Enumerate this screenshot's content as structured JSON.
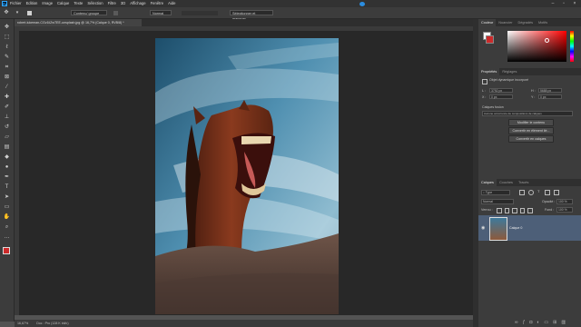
{
  "app": {
    "logo": "Ps"
  },
  "menu": [
    "Fichier",
    "Edition",
    "Image",
    "Calque",
    "Texte",
    "Sélection",
    "Filtre",
    "3D",
    "Affichage",
    "Fenêtre",
    "Aide"
  ],
  "options_bar": {
    "auto_select_label": "Contenu/ groupe",
    "style_label": "Normal",
    "select_subject_button": "Sélectionner et masquer..."
  },
  "document_tab": {
    "title": "robert-lukeman-CGv1iiZwTEE-unsplash.jpg @ 16,7% (Calque 0, RVB/8) *"
  },
  "status_bar": {
    "zoom": "16,67%",
    "info": "Doc : Pro (128 K bit/c)"
  },
  "color_panel": {
    "tabs": [
      "Couleur",
      "Nuancier",
      "Dégradés",
      "Motifs"
    ],
    "colors": {
      "hue_red": "#ff0000",
      "foreground": "#ffffff",
      "background": "#cc2a2a"
    }
  },
  "properties_panel": {
    "tabs": [
      "Propriétés",
      "Réglages"
    ],
    "section_title": "Objet dynamique incorporé",
    "fields": {
      "w_label": "L :",
      "w_value": "3792 px",
      "h_label": "H :",
      "h_value": "5688 px",
      "x_label": "X :",
      "x_value": "0 px",
      "y_label": "Y :",
      "y_value": "0 px"
    },
    "file_label": "Calques fusion",
    "placeholder_note": "Aucune occurrence de compositions de calques",
    "buttons": [
      "Modifier le contenu",
      "Convertir en élément lié...",
      "Convertir en calques"
    ]
  },
  "layers_panel": {
    "tabs": [
      "Calques",
      "Couches",
      "Tracés"
    ],
    "filter_label": "Type",
    "blend_mode": "Normal",
    "opacity_label": "Opacité :",
    "opacity_value": "100 %",
    "lock_label": "Verrou :",
    "fill_label": "Fond :",
    "fill_value": "100 %",
    "layers": [
      {
        "name": "Calque 0",
        "visible": true
      }
    ]
  },
  "toolbar_icons": [
    "move-icon",
    "marquee-icon",
    "lasso-icon",
    "quick-select-icon",
    "crop-icon",
    "frame-icon",
    "eyedropper-icon",
    "healing-icon",
    "brush-icon",
    "stamp-icon",
    "history-brush-icon",
    "eraser-icon",
    "gradient-icon",
    "blur-icon",
    "dodge-icon",
    "pen-icon",
    "type-icon",
    "path-select-icon",
    "shape-icon",
    "hand-icon",
    "zoom-icon",
    "more-icon"
  ]
}
